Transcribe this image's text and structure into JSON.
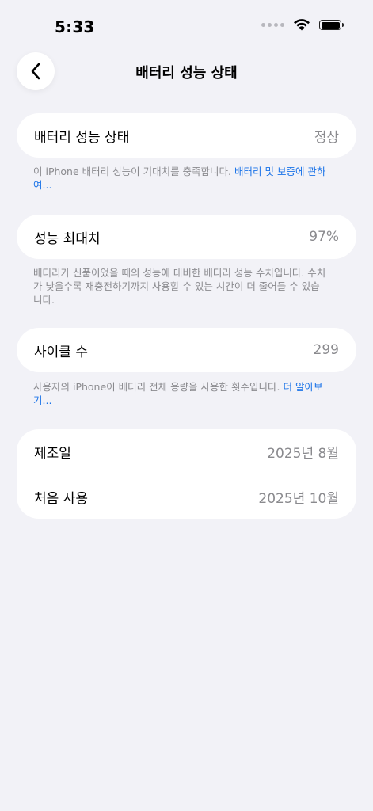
{
  "status_bar": {
    "time": "5:33"
  },
  "nav": {
    "title": "배터리 성능 상태"
  },
  "battery_health": {
    "label": "배터리 성능 상태",
    "value": "정상",
    "footer_text": "이 iPhone 배터리 성능이 기대치를 충족합니다. ",
    "footer_link": "배터리 및 보증에 관하여..."
  },
  "max_capacity": {
    "label": "성능 최대치",
    "value": "97%",
    "footer_text": "배터리가 신품이었을 때의 성능에 대비한 배터리 성능 수치입니다. 수치가 낮을수록 재충전하기까지 사용할 수 있는 시간이 더 줄어들 수 있습니다."
  },
  "cycle_count": {
    "label": "사이클 수",
    "value": "299",
    "footer_text": "사용자의 iPhone이 배터리 전체 용량을 사용한 횟수입니다. ",
    "footer_link": "더 알아보기..."
  },
  "dates": {
    "manufacture_label": "제조일",
    "manufacture_value": "2025년 8월",
    "first_use_label": "처음 사용",
    "first_use_value": "2025년 10월"
  },
  "colors": {
    "background": "#f2f2f7",
    "card": "#ffffff",
    "secondary_text": "#8a8a8e",
    "link": "#1a73e8"
  }
}
